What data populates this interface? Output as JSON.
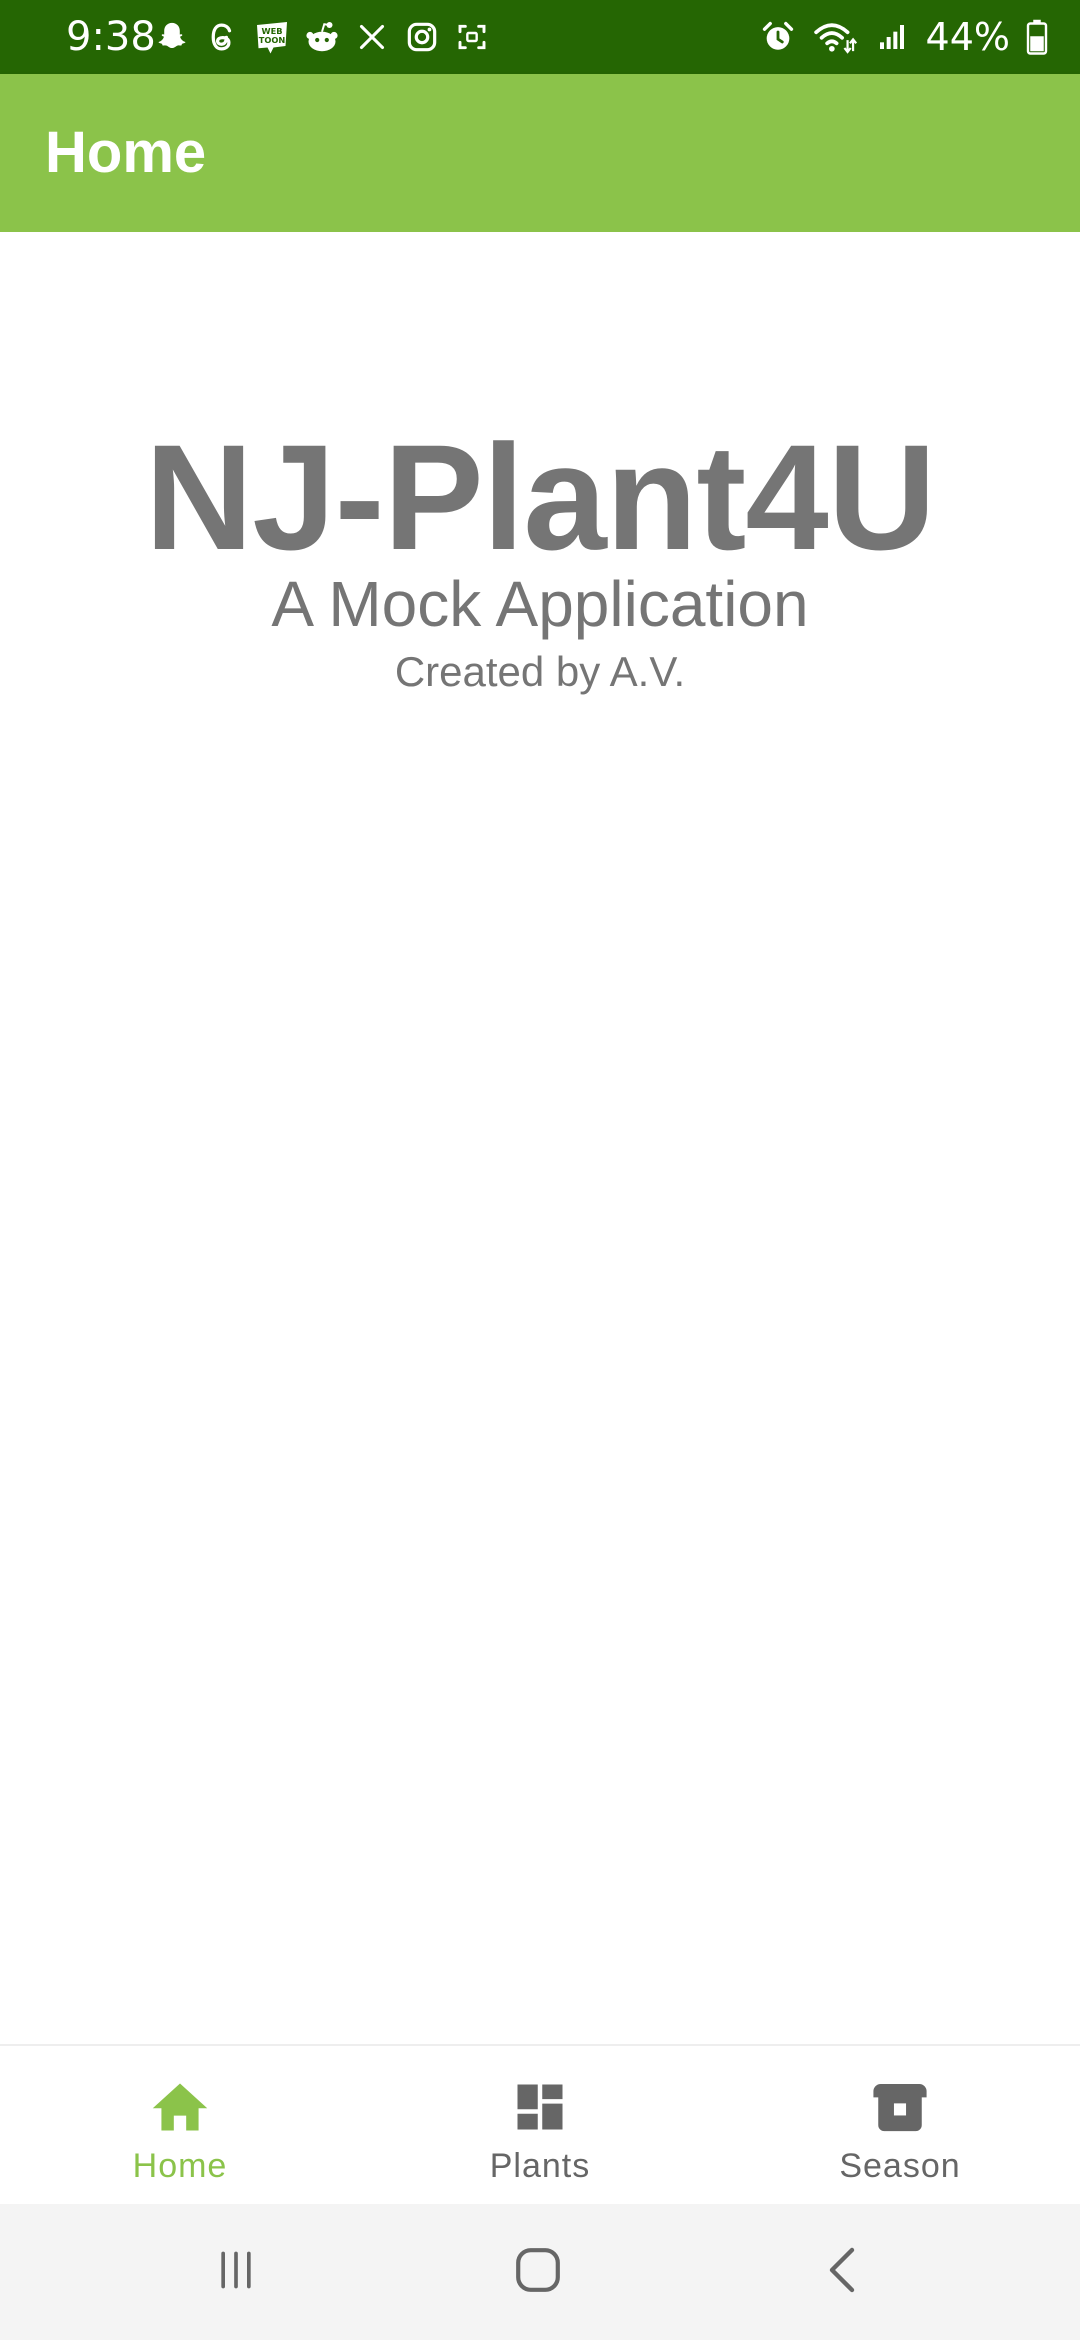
{
  "status_bar": {
    "time": "9:38",
    "battery_percent": "44%",
    "left_icons": [
      "snapchat-icon",
      "threads-icon",
      "webtoon-icon",
      "reddit-icon",
      "x-icon",
      "instagram-icon",
      "screenshot-icon"
    ],
    "right_icons": [
      "alarm-icon",
      "wifi-icon",
      "signal-icon",
      "battery-icon"
    ],
    "background_color": "#256603"
  },
  "app_bar": {
    "title": "Home",
    "background_color": "#8bc34a"
  },
  "main": {
    "app_name": "NJ-Plant4U",
    "subtitle": "A Mock Application",
    "credit": "Created by A.V."
  },
  "bottom_nav": {
    "items": [
      {
        "label": "Home",
        "icon": "home-icon",
        "active": true
      },
      {
        "label": "Plants",
        "icon": "dashboard-icon",
        "active": false
      },
      {
        "label": "Season",
        "icon": "season-icon",
        "active": false
      }
    ],
    "active_color": "#8bc34a",
    "inactive_color": "#666666"
  },
  "system_nav": {
    "buttons": [
      "recent-apps-icon",
      "home-circle-icon",
      "back-icon"
    ]
  }
}
